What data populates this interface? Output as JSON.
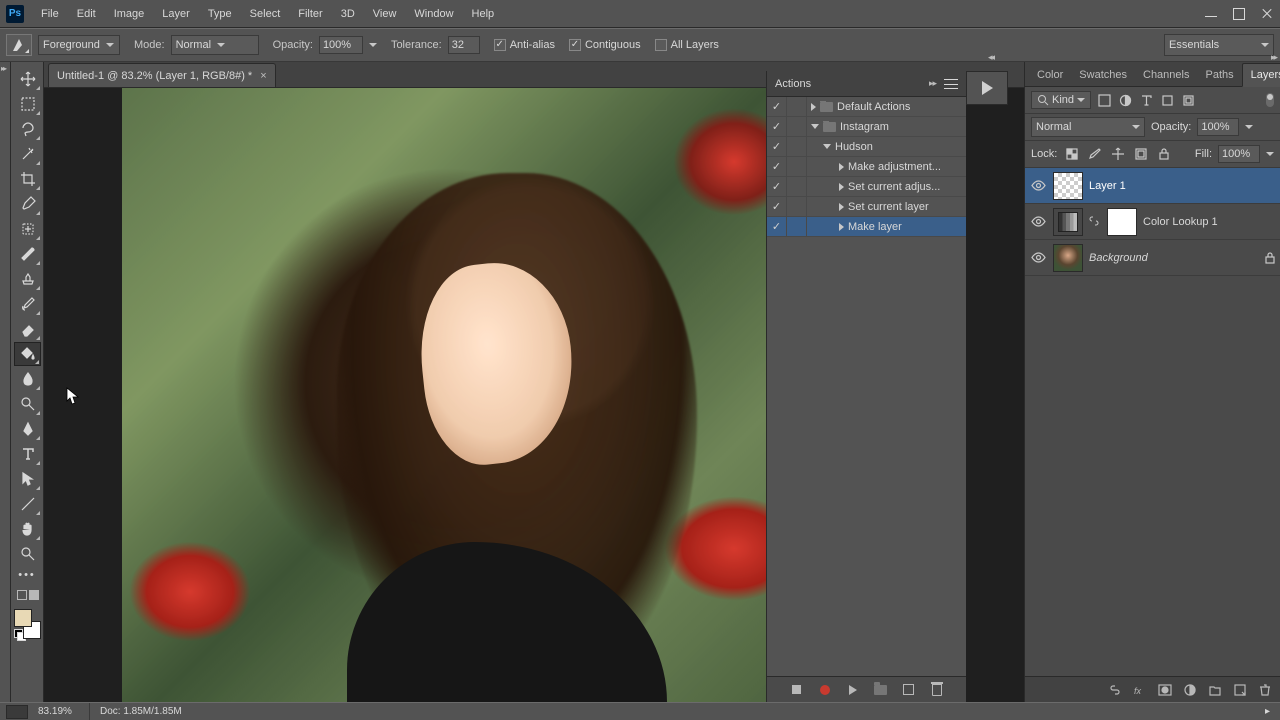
{
  "menu": {
    "items": [
      "File",
      "Edit",
      "Image",
      "Layer",
      "Type",
      "Select",
      "Filter",
      "3D",
      "View",
      "Window",
      "Help"
    ]
  },
  "options": {
    "fill_source": "Foreground",
    "mode_label": "Mode:",
    "mode_value": "Normal",
    "opacity_label": "Opacity:",
    "opacity_value": "100%",
    "tolerance_label": "Tolerance:",
    "tolerance_value": "32",
    "antialias_label": "Anti-alias",
    "contiguous_label": "Contiguous",
    "all_layers_label": "All Layers",
    "workspace_preset": "Essentials"
  },
  "document": {
    "tab_title": "Untitled-1 @ 83.2% (Layer 1, RGB/8#) *"
  },
  "actions_panel": {
    "title": "Actions",
    "rows": [
      {
        "check": true,
        "indent": 0,
        "twist": "right",
        "folder": true,
        "label": "Default Actions"
      },
      {
        "check": true,
        "indent": 0,
        "twist": "down",
        "folder": true,
        "label": "Instagram"
      },
      {
        "check": true,
        "indent": 1,
        "twist": "down",
        "folder": false,
        "label": "Hudson"
      },
      {
        "check": true,
        "indent": 2,
        "twist": "right",
        "folder": false,
        "label": "Make adjustment..."
      },
      {
        "check": true,
        "indent": 2,
        "twist": "right",
        "folder": false,
        "label": "Set current adjus..."
      },
      {
        "check": true,
        "indent": 2,
        "twist": "right",
        "folder": false,
        "label": "Set current layer"
      },
      {
        "check": true,
        "indent": 2,
        "twist": "right",
        "folder": false,
        "label": "Make layer",
        "selected": true
      }
    ]
  },
  "panel_tabs": {
    "items": [
      "Color",
      "Swatches",
      "Channels",
      "Paths",
      "Layers"
    ],
    "active": 4
  },
  "layers": {
    "kind_label": "Kind",
    "blend_mode": "Normal",
    "opacity_label": "Opacity:",
    "opacity_value": "100%",
    "lock_label": "Lock:",
    "fill_label": "Fill:",
    "fill_value": "100%",
    "rows": [
      {
        "name": "Layer 1",
        "thumb": "checker",
        "selected": true
      },
      {
        "name": "Color Lookup 1",
        "thumb": "lookup",
        "mask": true
      },
      {
        "name": "Background",
        "thumb": "photo",
        "italic": true,
        "locked": true
      }
    ]
  },
  "status": {
    "zoom": "83.19%",
    "doc_info": "Doc: 1.85M/1.85M"
  }
}
